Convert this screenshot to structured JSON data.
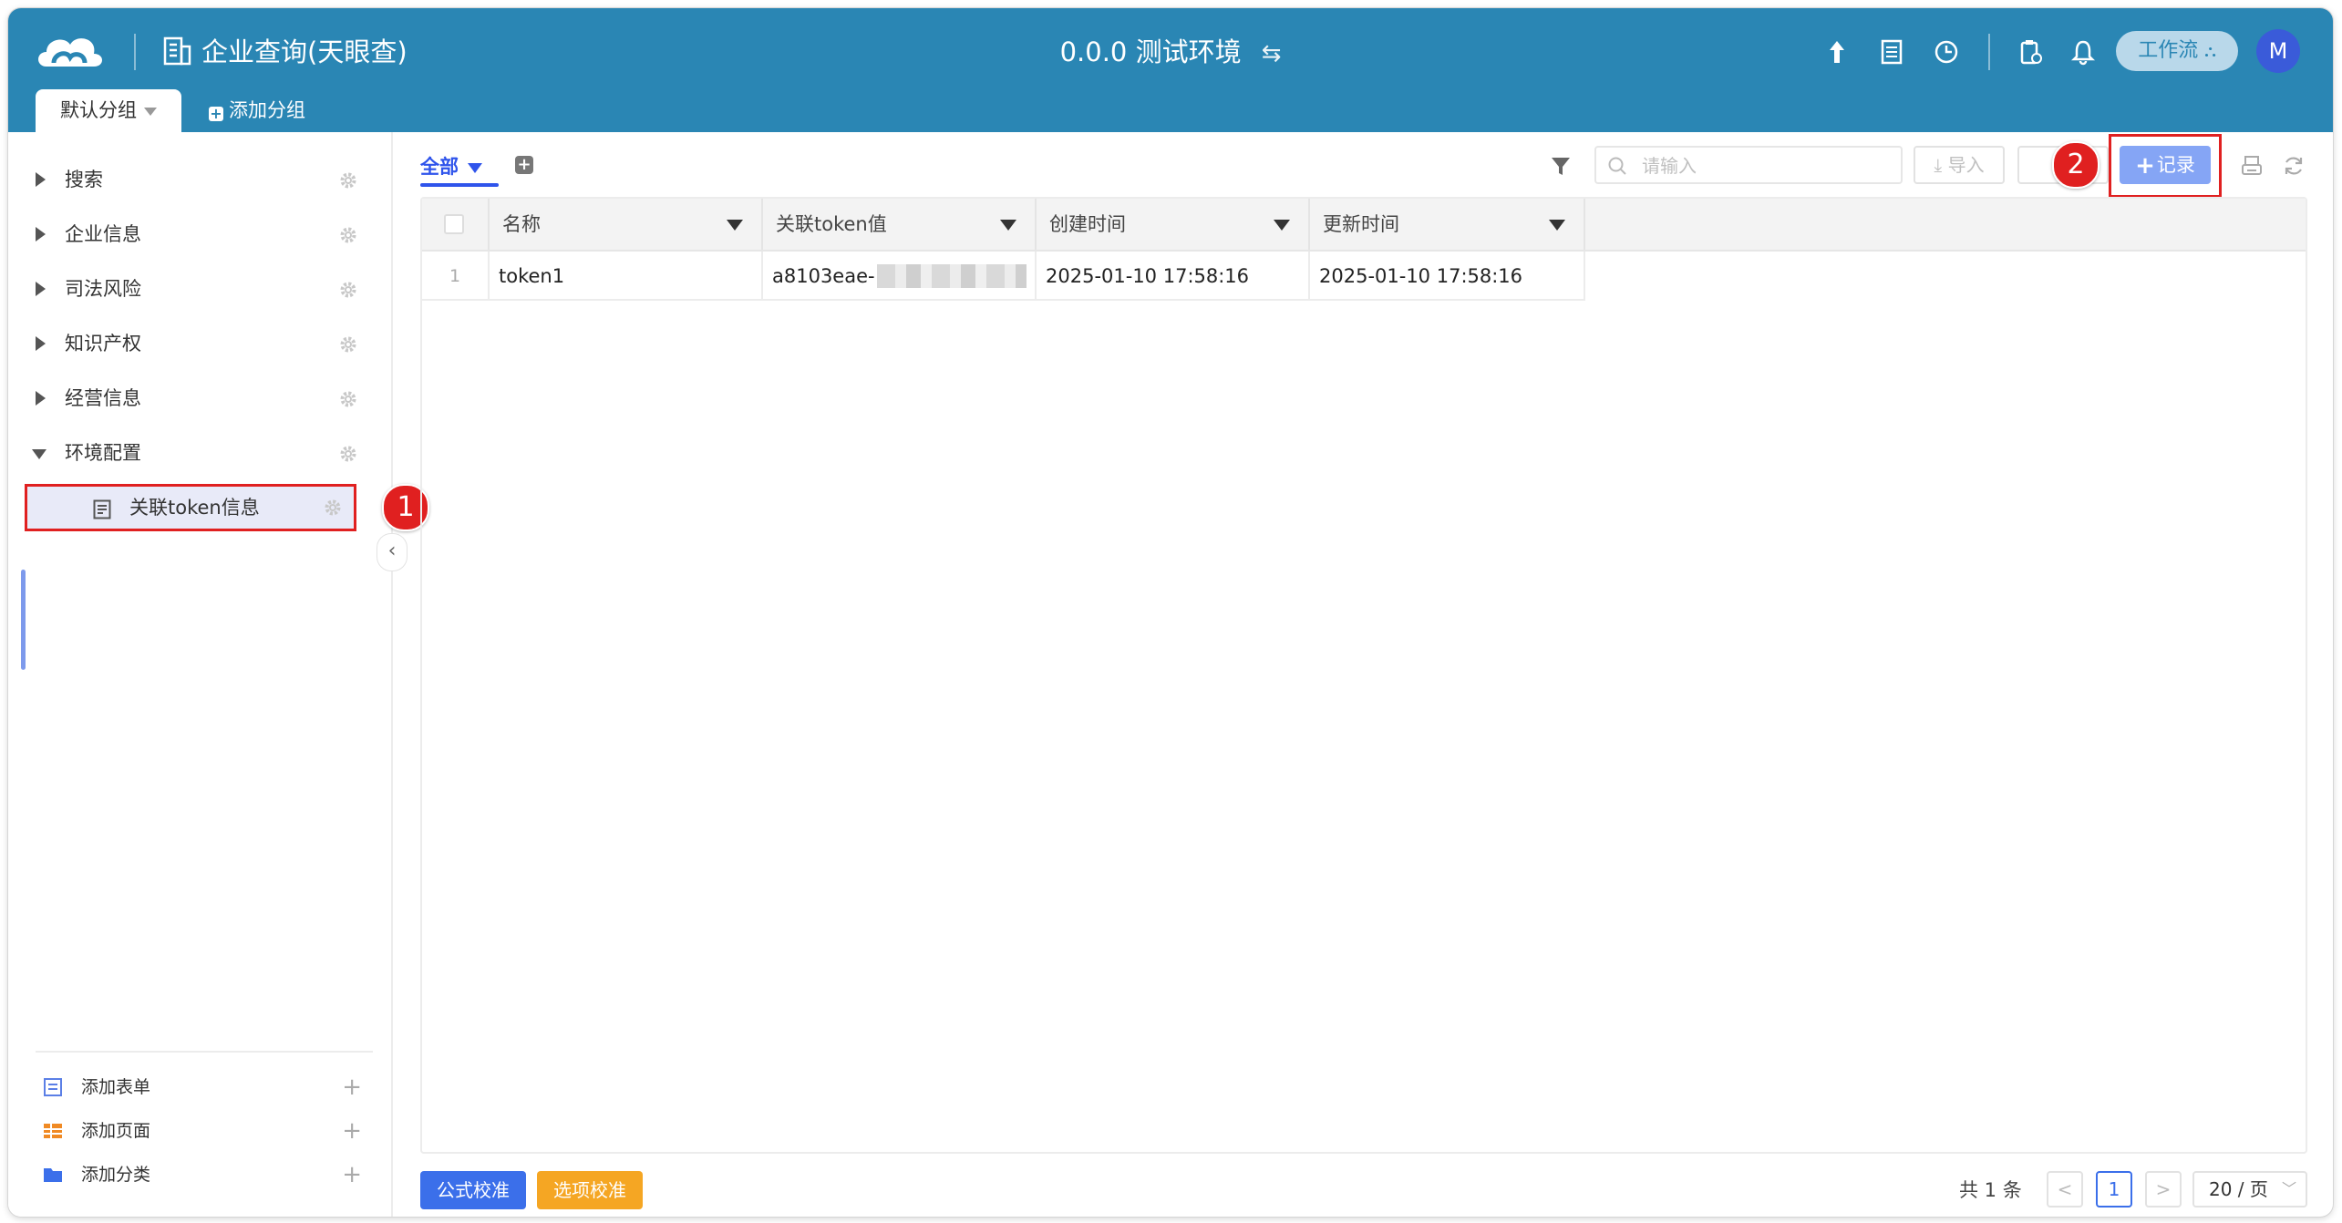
{
  "header": {
    "app_title": "企业查询(天眼查)",
    "environment": "0.0.0 测试环境",
    "swap_icon": "⇆",
    "workflow_label": "工作流",
    "avatar_letter": "M"
  },
  "tabs": {
    "active": "默认分组",
    "add": "添加分组"
  },
  "sidebar": {
    "items": [
      {
        "label": "搜索"
      },
      {
        "label": "企业信息"
      },
      {
        "label": "司法风险"
      },
      {
        "label": "知识产权"
      },
      {
        "label": "经营信息"
      },
      {
        "label": "环境配置"
      }
    ],
    "sub_item": "关联token信息",
    "footer": [
      {
        "label": "添加表单",
        "icon": "form-icon"
      },
      {
        "label": "添加页面",
        "icon": "table-page-icon"
      },
      {
        "label": "添加分类",
        "icon": "folder-icon"
      }
    ]
  },
  "annotations": {
    "first": "1",
    "second": "2"
  },
  "toolbar": {
    "view_tab": "全部",
    "search_placeholder": "请输入",
    "import_label": "导入",
    "record_label": "记录"
  },
  "table": {
    "columns": [
      "名称",
      "关联token值",
      "创建时间",
      "更新时间"
    ],
    "rows": [
      {
        "index": "1",
        "name": "token1",
        "token": "a8103eae-",
        "created": "2025-01-10 17:58:16",
        "updated": "2025-01-10 17:58:16"
      }
    ]
  },
  "footer": {
    "formula_btn": "公式校准",
    "option_btn": "选项校准",
    "total": "共 1 条",
    "prev": "<",
    "current_page": "1",
    "next": ">",
    "page_size": "20 / 页"
  },
  "colors": {
    "header_bg": "#2a86b4",
    "accent": "#2f54eb",
    "record_btn": "#85a5f5",
    "annotation_red": "#e02020",
    "option_btn": "#f5a623"
  }
}
